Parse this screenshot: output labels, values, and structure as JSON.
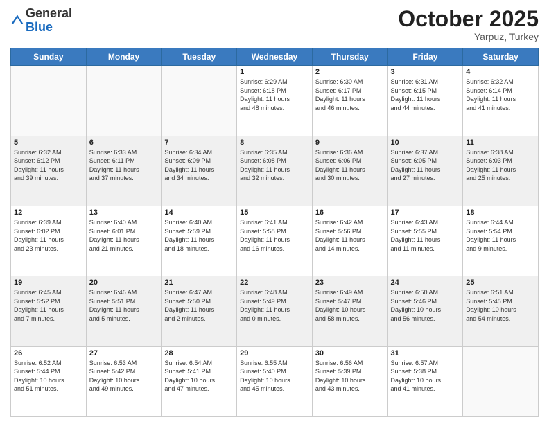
{
  "header": {
    "logo_line1": "General",
    "logo_line2": "Blue",
    "month": "October 2025",
    "location": "Yarpuz, Turkey"
  },
  "weekdays": [
    "Sunday",
    "Monday",
    "Tuesday",
    "Wednesday",
    "Thursday",
    "Friday",
    "Saturday"
  ],
  "weeks": [
    [
      {
        "day": "",
        "info": "",
        "empty": true
      },
      {
        "day": "",
        "info": "",
        "empty": true
      },
      {
        "day": "",
        "info": "",
        "empty": true
      },
      {
        "day": "1",
        "info": "Sunrise: 6:29 AM\nSunset: 6:18 PM\nDaylight: 11 hours\nand 48 minutes."
      },
      {
        "day": "2",
        "info": "Sunrise: 6:30 AM\nSunset: 6:17 PM\nDaylight: 11 hours\nand 46 minutes."
      },
      {
        "day": "3",
        "info": "Sunrise: 6:31 AM\nSunset: 6:15 PM\nDaylight: 11 hours\nand 44 minutes."
      },
      {
        "day": "4",
        "info": "Sunrise: 6:32 AM\nSunset: 6:14 PM\nDaylight: 11 hours\nand 41 minutes."
      }
    ],
    [
      {
        "day": "5",
        "info": "Sunrise: 6:32 AM\nSunset: 6:12 PM\nDaylight: 11 hours\nand 39 minutes.",
        "shaded": true
      },
      {
        "day": "6",
        "info": "Sunrise: 6:33 AM\nSunset: 6:11 PM\nDaylight: 11 hours\nand 37 minutes.",
        "shaded": true
      },
      {
        "day": "7",
        "info": "Sunrise: 6:34 AM\nSunset: 6:09 PM\nDaylight: 11 hours\nand 34 minutes.",
        "shaded": true
      },
      {
        "day": "8",
        "info": "Sunrise: 6:35 AM\nSunset: 6:08 PM\nDaylight: 11 hours\nand 32 minutes.",
        "shaded": true
      },
      {
        "day": "9",
        "info": "Sunrise: 6:36 AM\nSunset: 6:06 PM\nDaylight: 11 hours\nand 30 minutes.",
        "shaded": true
      },
      {
        "day": "10",
        "info": "Sunrise: 6:37 AM\nSunset: 6:05 PM\nDaylight: 11 hours\nand 27 minutes.",
        "shaded": true
      },
      {
        "day": "11",
        "info": "Sunrise: 6:38 AM\nSunset: 6:03 PM\nDaylight: 11 hours\nand 25 minutes.",
        "shaded": true
      }
    ],
    [
      {
        "day": "12",
        "info": "Sunrise: 6:39 AM\nSunset: 6:02 PM\nDaylight: 11 hours\nand 23 minutes."
      },
      {
        "day": "13",
        "info": "Sunrise: 6:40 AM\nSunset: 6:01 PM\nDaylight: 11 hours\nand 21 minutes."
      },
      {
        "day": "14",
        "info": "Sunrise: 6:40 AM\nSunset: 5:59 PM\nDaylight: 11 hours\nand 18 minutes."
      },
      {
        "day": "15",
        "info": "Sunrise: 6:41 AM\nSunset: 5:58 PM\nDaylight: 11 hours\nand 16 minutes."
      },
      {
        "day": "16",
        "info": "Sunrise: 6:42 AM\nSunset: 5:56 PM\nDaylight: 11 hours\nand 14 minutes."
      },
      {
        "day": "17",
        "info": "Sunrise: 6:43 AM\nSunset: 5:55 PM\nDaylight: 11 hours\nand 11 minutes."
      },
      {
        "day": "18",
        "info": "Sunrise: 6:44 AM\nSunset: 5:54 PM\nDaylight: 11 hours\nand 9 minutes."
      }
    ],
    [
      {
        "day": "19",
        "info": "Sunrise: 6:45 AM\nSunset: 5:52 PM\nDaylight: 11 hours\nand 7 minutes.",
        "shaded": true
      },
      {
        "day": "20",
        "info": "Sunrise: 6:46 AM\nSunset: 5:51 PM\nDaylight: 11 hours\nand 5 minutes.",
        "shaded": true
      },
      {
        "day": "21",
        "info": "Sunrise: 6:47 AM\nSunset: 5:50 PM\nDaylight: 11 hours\nand 2 minutes.",
        "shaded": true
      },
      {
        "day": "22",
        "info": "Sunrise: 6:48 AM\nSunset: 5:49 PM\nDaylight: 11 hours\nand 0 minutes.",
        "shaded": true
      },
      {
        "day": "23",
        "info": "Sunrise: 6:49 AM\nSunset: 5:47 PM\nDaylight: 10 hours\nand 58 minutes.",
        "shaded": true
      },
      {
        "day": "24",
        "info": "Sunrise: 6:50 AM\nSunset: 5:46 PM\nDaylight: 10 hours\nand 56 minutes.",
        "shaded": true
      },
      {
        "day": "25",
        "info": "Sunrise: 6:51 AM\nSunset: 5:45 PM\nDaylight: 10 hours\nand 54 minutes.",
        "shaded": true
      }
    ],
    [
      {
        "day": "26",
        "info": "Sunrise: 6:52 AM\nSunset: 5:44 PM\nDaylight: 10 hours\nand 51 minutes."
      },
      {
        "day": "27",
        "info": "Sunrise: 6:53 AM\nSunset: 5:42 PM\nDaylight: 10 hours\nand 49 minutes."
      },
      {
        "day": "28",
        "info": "Sunrise: 6:54 AM\nSunset: 5:41 PM\nDaylight: 10 hours\nand 47 minutes."
      },
      {
        "day": "29",
        "info": "Sunrise: 6:55 AM\nSunset: 5:40 PM\nDaylight: 10 hours\nand 45 minutes."
      },
      {
        "day": "30",
        "info": "Sunrise: 6:56 AM\nSunset: 5:39 PM\nDaylight: 10 hours\nand 43 minutes."
      },
      {
        "day": "31",
        "info": "Sunrise: 6:57 AM\nSunset: 5:38 PM\nDaylight: 10 hours\nand 41 minutes."
      },
      {
        "day": "",
        "info": "",
        "empty": true
      }
    ]
  ]
}
